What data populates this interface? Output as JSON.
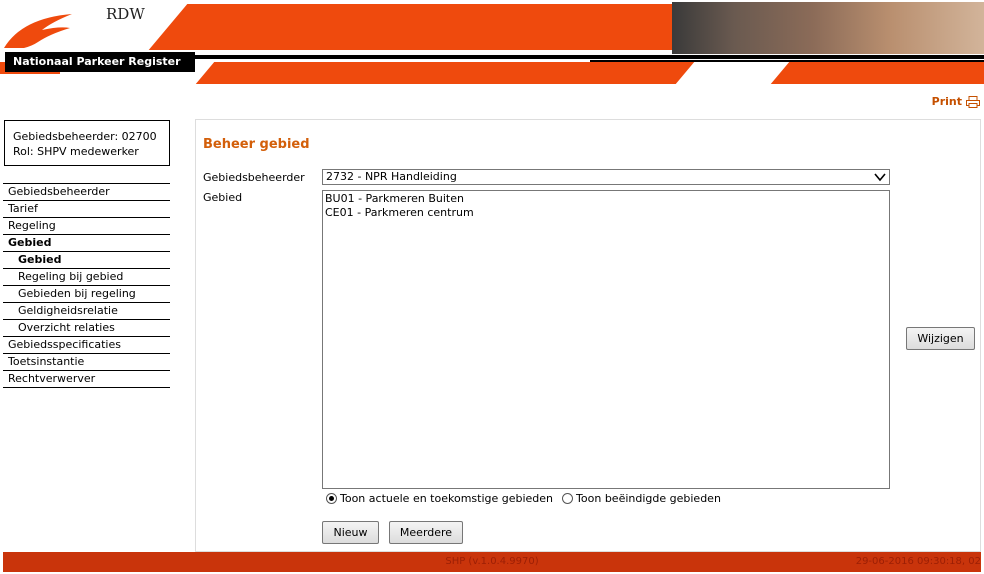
{
  "header": {
    "brand": "RDW",
    "site_title": "Nationaal Parkeer Register"
  },
  "print_label": "Print",
  "user": {
    "line1": "Gebiedsbeheerder: 02700",
    "line2": "Rol: SHPV medewerker"
  },
  "sidebar": {
    "items": [
      {
        "label": "Gebiedsbeheerder",
        "sub": false,
        "active": false
      },
      {
        "label": "Tarief",
        "sub": false,
        "active": false
      },
      {
        "label": "Regeling",
        "sub": false,
        "active": false
      },
      {
        "label": "Gebied",
        "sub": false,
        "active": true
      },
      {
        "label": "Gebied",
        "sub": true,
        "active": true
      },
      {
        "label": "Regeling bij gebied",
        "sub": true,
        "active": false
      },
      {
        "label": "Gebieden bij regeling",
        "sub": true,
        "active": false
      },
      {
        "label": "Geldigheidsrelatie",
        "sub": true,
        "active": false
      },
      {
        "label": "Overzicht relaties",
        "sub": true,
        "active": false
      },
      {
        "label": "Gebiedsspecificaties",
        "sub": false,
        "active": false
      },
      {
        "label": "Toetsinstantie",
        "sub": false,
        "active": false
      },
      {
        "label": "Rechtverwerver",
        "sub": false,
        "active": false
      }
    ]
  },
  "main": {
    "title": "Beheer gebied",
    "beheerder_label": "Gebiedsbeheerder",
    "beheerder_value": "2732 - NPR Handleiding",
    "gebied_label": "Gebied",
    "gebieden": [
      "BU01 - Parkmeren Buiten",
      "CE01 - Parkmeren centrum"
    ],
    "radio_current": "Toon actuele en toekomstige gebieden",
    "radio_ended": "Toon beëindigde gebieden",
    "radio_selected": "current",
    "btn_nieuw": "Nieuw",
    "btn_meerdere": "Meerdere",
    "btn_wijzigen": "Wijzigen"
  },
  "footer": {
    "version": "SHP (v.1.0.4.9970)",
    "timestamp": "29-06-2016 09:30:18, 02"
  },
  "colors": {
    "brand_orange": "#ef4a0d",
    "title_orange": "#d35f0a",
    "footer_red": "#c9340b"
  }
}
